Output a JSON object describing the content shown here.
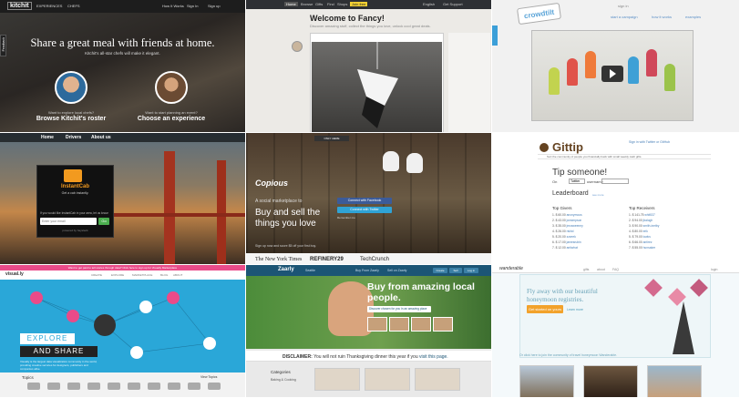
{
  "kitchit": {
    "logo": "kitchit",
    "nav": [
      "EXPERIENCES",
      "CHEFS"
    ],
    "nav_right": [
      "How It Works",
      "Sign In",
      "Sign up"
    ],
    "feedback": "Feedback",
    "headline": "Share a great meal with friends at home.",
    "subline": "Kitchit's all-star chefs will make it elegant.",
    "left_caption": "Want to explore local chefs?",
    "left_cta": "Browse Kitchit's roster",
    "right_caption": "Want to start planning an event?",
    "right_cta": "Choose an experience",
    "colors": {
      "bg": "#2a2623",
      "text": "#ffffff"
    }
  },
  "fancy": {
    "nav": [
      "Home",
      "Browse",
      "Gifts",
      "Find",
      "Shops",
      "Join free"
    ],
    "nav_right": [
      "English",
      "Get Support"
    ],
    "title": "Welcome to Fancy!",
    "subtitle": "Discover amazing stuff, collect the things you love, unlock cool great deals."
  },
  "crowdtilt": {
    "logo": "crowdtilt",
    "nav": [
      "start a campaign",
      "how it works",
      "examples"
    ],
    "top_right": "sign in",
    "side_tab": "Feedback"
  },
  "instantcab": {
    "nav": [
      "Home",
      "Drivers",
      "About us"
    ],
    "name": "InstantCab",
    "tagline": "Get a cab instantly.",
    "label": "If you would like InstantCab in your area, let us know:",
    "field_placeholder": "Enter your email",
    "button": "Go",
    "powered": "powered by haystack"
  },
  "copious": {
    "logo": "Copious",
    "pretitle": "A social marketplace to",
    "headline": "Buy and sell the things you love",
    "facebook": "Connect with Facebook",
    "twitter": "Connect with Twitter",
    "remember": "Remember me",
    "small": "Sign up now and score $5 off your first buy.",
    "press": [
      "The New York Times",
      "REFINERY29",
      "TechCrunch"
    ],
    "popular": "ONLY HERE"
  },
  "gittip": {
    "logo": "Gittip",
    "sign_in": "Sign in with Twitter or GitHub",
    "bar_text": "Sort the community of people you financially back with small weekly cash gifts.",
    "tip_title": "Tip someone!",
    "tip_on": "On",
    "platform": "Twitter",
    "username_label": "username",
    "leaderboard": "Leaderboard",
    "leaderboard_link": "see more",
    "givers_header": "Top Givers",
    "receivers_header": "Top Receivers",
    "givers": [
      {
        "rank": "1.",
        "amount": "$",
        "value": "60.00",
        "name": "anonymous"
      },
      {
        "rank": "2.",
        "amount": "$",
        "value": "43.00",
        "name": "jonsimpson"
      },
      {
        "rank": "3.",
        "amount": "$",
        "value": "35.00",
        "name": "jmcsweeney"
      },
      {
        "rank": "4.",
        "amount": "$",
        "value": "26.00",
        "name": "rishid"
      },
      {
        "rank": "5.",
        "amount": "$",
        "value": "20.00",
        "name": "zzzeek"
      },
      {
        "rank": "6.",
        "amount": "$",
        "value": "17.00",
        "name": "jamesrubin"
      },
      {
        "rank": "7.",
        "amount": "$",
        "value": "12.00",
        "name": "antiwhat"
      }
    ],
    "receivers": [
      {
        "rank": "1.",
        "amount": "$",
        "value": "141.75",
        "name": "whit537"
      },
      {
        "rank": "2.",
        "amount": "$",
        "value": "94.00",
        "name": "jbalogh"
      },
      {
        "rank": "3.",
        "amount": "$",
        "value": "90.00",
        "name": "smith-inetby"
      },
      {
        "rank": "4.",
        "amount": "$",
        "value": "80.00",
        "name": "erik"
      },
      {
        "rank": "5.",
        "amount": "$",
        "value": "79.00",
        "name": "lowks"
      },
      {
        "rank": "6.",
        "amount": "$",
        "value": "66.00",
        "name": "antirez"
      },
      {
        "rank": "7.",
        "amount": "$",
        "value": "55.00",
        "name": "hunsaker"
      }
    ]
  },
  "visually": {
    "topbar": "Want to get paid to tell stories through data? Click here to sign up for Visually Marketplace",
    "logo": "visual.ly",
    "nav": [
      "CREATE",
      "EXPLORE",
      "MARKETPLACE",
      "BLOG",
      "ABOUT"
    ],
    "explore": "EXPLORE",
    "share": "AND SHARE",
    "desc": "Visually is the largest data visualization community in the world, providing creative services for designers, publishers and companies alike.",
    "topics": "Topics",
    "view_topics": "View Topics",
    "categories": [
      "Animals",
      "Business",
      "Computers",
      "Economy",
      "Education",
      "Entertainment",
      "Environment",
      "Food",
      "Gaming",
      "Geography"
    ]
  },
  "zaarly": {
    "logo": "Zaarly",
    "nav": [
      "Seattle",
      "Buy From Zaarly",
      "Sell on Zaarly"
    ],
    "buttons": [
      "Create",
      "Sell",
      "Log in"
    ],
    "headline": "Buy from amazing local people.",
    "cta": "Discover chosen for you in an amazing place",
    "disclaimer_label": "DISCLAIMER:",
    "disclaimer_text": "You will not ruin Thanksgiving dinner this year if you",
    "disclaimer_link": "visit this page.",
    "categories_label": "Categories",
    "category_1": "Baking & Cooking"
  },
  "wanderable": {
    "logo": "wanderable",
    "nav": [
      "gifts",
      "about",
      "FAQ",
      "login"
    ],
    "headline": "Fly away with our beautiful honeymoon registries.",
    "cta": "Get started on yours",
    "learn": "Learn more",
    "foot": "Or click here to join the community of travel honeymoon Wanderable."
  }
}
